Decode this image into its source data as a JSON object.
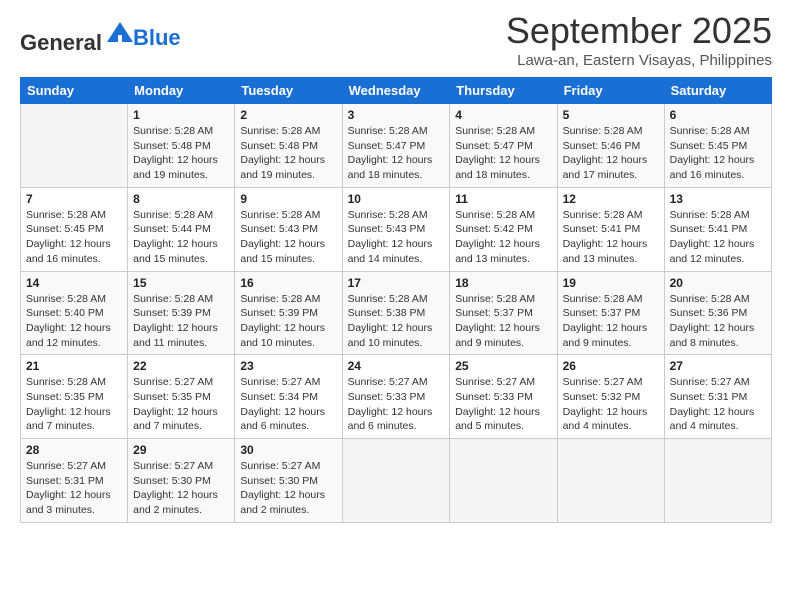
{
  "header": {
    "logo_line1": "General",
    "logo_line2": "Blue",
    "month_title": "September 2025",
    "location": "Lawa-an, Eastern Visayas, Philippines"
  },
  "weekdays": [
    "Sunday",
    "Monday",
    "Tuesday",
    "Wednesday",
    "Thursday",
    "Friday",
    "Saturday"
  ],
  "weeks": [
    [
      {
        "day": "",
        "info": ""
      },
      {
        "day": "1",
        "info": "Sunrise: 5:28 AM\nSunset: 5:48 PM\nDaylight: 12 hours\nand 19 minutes."
      },
      {
        "day": "2",
        "info": "Sunrise: 5:28 AM\nSunset: 5:48 PM\nDaylight: 12 hours\nand 19 minutes."
      },
      {
        "day": "3",
        "info": "Sunrise: 5:28 AM\nSunset: 5:47 PM\nDaylight: 12 hours\nand 18 minutes."
      },
      {
        "day": "4",
        "info": "Sunrise: 5:28 AM\nSunset: 5:47 PM\nDaylight: 12 hours\nand 18 minutes."
      },
      {
        "day": "5",
        "info": "Sunrise: 5:28 AM\nSunset: 5:46 PM\nDaylight: 12 hours\nand 17 minutes."
      },
      {
        "day": "6",
        "info": "Sunrise: 5:28 AM\nSunset: 5:45 PM\nDaylight: 12 hours\nand 16 minutes."
      }
    ],
    [
      {
        "day": "7",
        "info": "Sunrise: 5:28 AM\nSunset: 5:45 PM\nDaylight: 12 hours\nand 16 minutes."
      },
      {
        "day": "8",
        "info": "Sunrise: 5:28 AM\nSunset: 5:44 PM\nDaylight: 12 hours\nand 15 minutes."
      },
      {
        "day": "9",
        "info": "Sunrise: 5:28 AM\nSunset: 5:43 PM\nDaylight: 12 hours\nand 15 minutes."
      },
      {
        "day": "10",
        "info": "Sunrise: 5:28 AM\nSunset: 5:43 PM\nDaylight: 12 hours\nand 14 minutes."
      },
      {
        "day": "11",
        "info": "Sunrise: 5:28 AM\nSunset: 5:42 PM\nDaylight: 12 hours\nand 13 minutes."
      },
      {
        "day": "12",
        "info": "Sunrise: 5:28 AM\nSunset: 5:41 PM\nDaylight: 12 hours\nand 13 minutes."
      },
      {
        "day": "13",
        "info": "Sunrise: 5:28 AM\nSunset: 5:41 PM\nDaylight: 12 hours\nand 12 minutes."
      }
    ],
    [
      {
        "day": "14",
        "info": "Sunrise: 5:28 AM\nSunset: 5:40 PM\nDaylight: 12 hours\nand 12 minutes."
      },
      {
        "day": "15",
        "info": "Sunrise: 5:28 AM\nSunset: 5:39 PM\nDaylight: 12 hours\nand 11 minutes."
      },
      {
        "day": "16",
        "info": "Sunrise: 5:28 AM\nSunset: 5:39 PM\nDaylight: 12 hours\nand 10 minutes."
      },
      {
        "day": "17",
        "info": "Sunrise: 5:28 AM\nSunset: 5:38 PM\nDaylight: 12 hours\nand 10 minutes."
      },
      {
        "day": "18",
        "info": "Sunrise: 5:28 AM\nSunset: 5:37 PM\nDaylight: 12 hours\nand 9 minutes."
      },
      {
        "day": "19",
        "info": "Sunrise: 5:28 AM\nSunset: 5:37 PM\nDaylight: 12 hours\nand 9 minutes."
      },
      {
        "day": "20",
        "info": "Sunrise: 5:28 AM\nSunset: 5:36 PM\nDaylight: 12 hours\nand 8 minutes."
      }
    ],
    [
      {
        "day": "21",
        "info": "Sunrise: 5:28 AM\nSunset: 5:35 PM\nDaylight: 12 hours\nand 7 minutes."
      },
      {
        "day": "22",
        "info": "Sunrise: 5:27 AM\nSunset: 5:35 PM\nDaylight: 12 hours\nand 7 minutes."
      },
      {
        "day": "23",
        "info": "Sunrise: 5:27 AM\nSunset: 5:34 PM\nDaylight: 12 hours\nand 6 minutes."
      },
      {
        "day": "24",
        "info": "Sunrise: 5:27 AM\nSunset: 5:33 PM\nDaylight: 12 hours\nand 6 minutes."
      },
      {
        "day": "25",
        "info": "Sunrise: 5:27 AM\nSunset: 5:33 PM\nDaylight: 12 hours\nand 5 minutes."
      },
      {
        "day": "26",
        "info": "Sunrise: 5:27 AM\nSunset: 5:32 PM\nDaylight: 12 hours\nand 4 minutes."
      },
      {
        "day": "27",
        "info": "Sunrise: 5:27 AM\nSunset: 5:31 PM\nDaylight: 12 hours\nand 4 minutes."
      }
    ],
    [
      {
        "day": "28",
        "info": "Sunrise: 5:27 AM\nSunset: 5:31 PM\nDaylight: 12 hours\nand 3 minutes."
      },
      {
        "day": "29",
        "info": "Sunrise: 5:27 AM\nSunset: 5:30 PM\nDaylight: 12 hours\nand 2 minutes."
      },
      {
        "day": "30",
        "info": "Sunrise: 5:27 AM\nSunset: 5:30 PM\nDaylight: 12 hours\nand 2 minutes."
      },
      {
        "day": "",
        "info": ""
      },
      {
        "day": "",
        "info": ""
      },
      {
        "day": "",
        "info": ""
      },
      {
        "day": "",
        "info": ""
      }
    ]
  ]
}
